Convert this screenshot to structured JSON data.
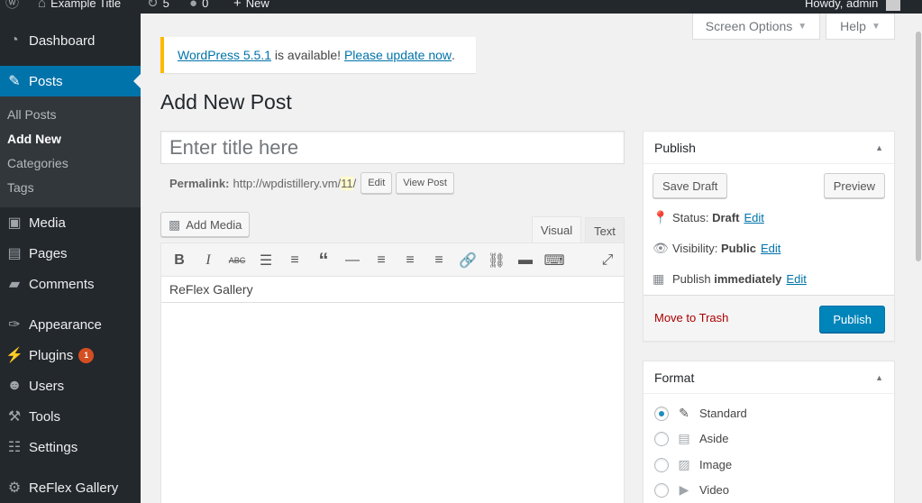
{
  "adminbar": {
    "site_name": "Example Title",
    "updates_count": "5",
    "comments_count": "0",
    "new_label": "New",
    "howdy": "Howdy, admin"
  },
  "sidebar": {
    "items": [
      {
        "label": "Dashboard",
        "icon": "dashboard-icon"
      },
      {
        "label": "Posts",
        "icon": "pin-icon"
      },
      {
        "label": "Media",
        "icon": "media-icon"
      },
      {
        "label": "Pages",
        "icon": "pages-icon"
      },
      {
        "label": "Comments",
        "icon": "comments-icon"
      },
      {
        "label": "Appearance",
        "icon": "brush-icon"
      },
      {
        "label": "Plugins",
        "icon": "plugin-icon",
        "badge": "1"
      },
      {
        "label": "Users",
        "icon": "users-icon"
      },
      {
        "label": "Tools",
        "icon": "wrench-icon"
      },
      {
        "label": "Settings",
        "icon": "settings-icon"
      },
      {
        "label": "ReFlex Gallery",
        "icon": "gear-icon"
      }
    ],
    "submenu": [
      "All Posts",
      "Add New",
      "Categories",
      "Tags"
    ]
  },
  "screen_options_label": "Screen Options",
  "help_label": "Help",
  "notice": {
    "link1": "WordPress 5.5.1",
    "middle": " is available! ",
    "link2": "Please update now",
    "end": "."
  },
  "page_title": "Add New Post",
  "title_placeholder": "Enter title here",
  "permalink": {
    "label": "Permalink:",
    "url": "http://wpdistillery.vm/",
    "slug": "11",
    "trail": "/",
    "edit_label": "Edit",
    "view_label": "View Post"
  },
  "editor": {
    "add_media_label": "Add Media",
    "tab_visual": "Visual",
    "tab_text": "Text",
    "content_first_line": "ReFlex Gallery"
  },
  "publish_box": {
    "title": "Publish",
    "save_draft": "Save Draft",
    "preview": "Preview",
    "status_label": "Status:",
    "status_value": "Draft",
    "visibility_label": "Visibility:",
    "visibility_value": "Public",
    "publish_label": "Publish",
    "publish_value": "immediately",
    "edit": "Edit",
    "trash": "Move to Trash",
    "publish_button": "Publish"
  },
  "format_box": {
    "title": "Format",
    "options": [
      "Standard",
      "Aside",
      "Image",
      "Video"
    ],
    "selected": "Standard"
  },
  "colors": {
    "admin_dark": "#23282d",
    "accent_blue": "#0073aa",
    "publish_button": "#0085ba",
    "notice_border": "#ffb900",
    "trash_red": "#a00"
  }
}
